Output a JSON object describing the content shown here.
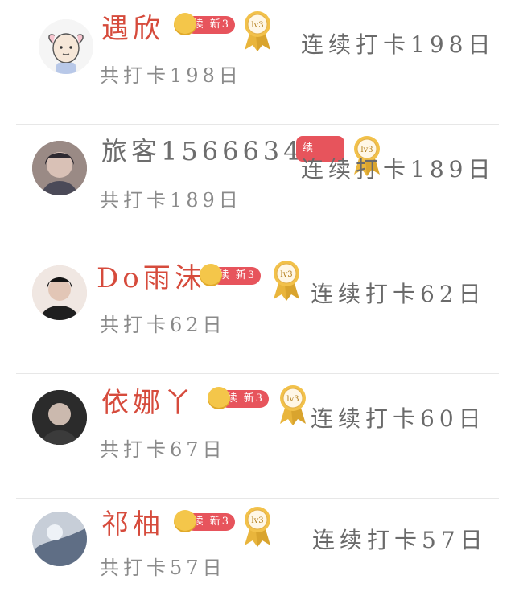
{
  "rows": [
    {
      "name": "遇欣",
      "total": "共打卡198日",
      "streak": "连续打卡198日",
      "vip": "续 新3",
      "level": "lv3"
    },
    {
      "name": "旅客1566634…",
      "total": "共打卡189日",
      "streak": "连续打卡189日",
      "vip": "续",
      "level": "lv3"
    },
    {
      "name": "Do雨沫",
      "total": "共打卡62日",
      "streak": "连续打卡62日",
      "vip": "续 新3",
      "level": "lv3"
    },
    {
      "name": "依娜丫",
      "total": "共打卡67日",
      "streak": "连续打卡60日",
      "vip": "续 新3",
      "level": "lv3"
    },
    {
      "name": "祁柚",
      "total": "共打卡57日",
      "streak": "连续打卡57日",
      "vip": "续 新3",
      "level": "lv3"
    }
  ],
  "colors": {
    "name_red": "#d64b3c",
    "pill_red": "#e7545c",
    "gold": "#f4c64a"
  }
}
